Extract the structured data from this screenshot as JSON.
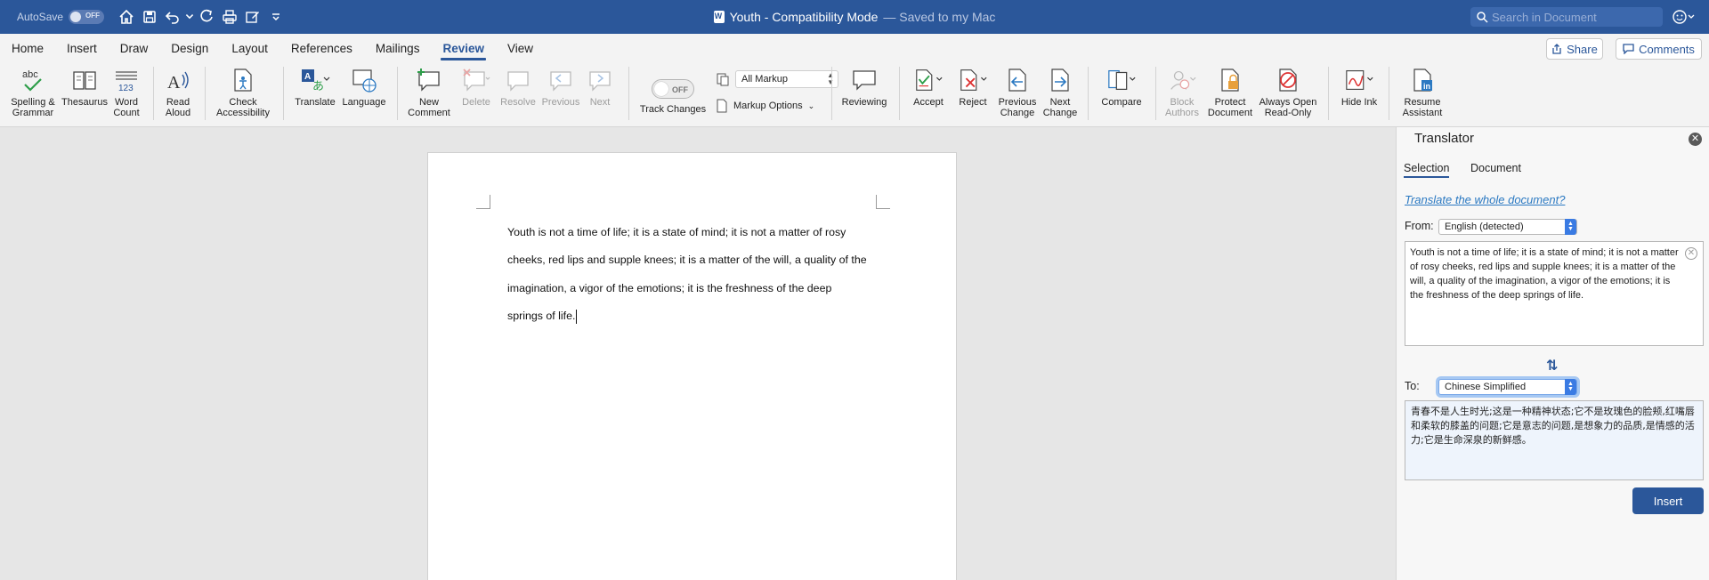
{
  "titlebar": {
    "autosave_label": "AutoSave",
    "autosave_state": "OFF",
    "doc_title": "Youth  -  Compatibility Mode",
    "saved_status": "— Saved to my Mac",
    "search_placeholder": "Search in Document"
  },
  "tabs": [
    "Home",
    "Insert",
    "Draw",
    "Design",
    "Layout",
    "References",
    "Mailings",
    "Review",
    "View"
  ],
  "active_tab": "Review",
  "share_label": "Share",
  "comments_label": "Comments",
  "ribbon": {
    "spelling": "Spelling &\nGrammar",
    "thesaurus": "Thesaurus",
    "word_count": "Word\nCount",
    "read_aloud": "Read\nAloud",
    "check_accessibility": "Check\nAccessibility",
    "translate": "Translate",
    "language": "Language",
    "new_comment": "New\nComment",
    "delete": "Delete",
    "resolve": "Resolve",
    "previous": "Previous",
    "next": "Next",
    "track_changes_state": "OFF",
    "track_changes": "Track Changes",
    "markup_value": "All Markup",
    "markup_options": "Markup Options",
    "reviewing": "Reviewing",
    "accept": "Accept",
    "reject": "Reject",
    "previous_change": "Previous\nChange",
    "next_change": "Next\nChange",
    "compare": "Compare",
    "block_authors": "Block\nAuthors",
    "protect_document": "Protect\nDocument",
    "always_open_readonly": "Always Open\nRead-Only",
    "hide_ink": "Hide Ink",
    "resume_assistant": "Resume\nAssistant"
  },
  "document": {
    "lines": [
      "Youth is not a time of life; it is a state of mind; it is not a matter of rosy",
      "cheeks, red lips and supple knees; it is a matter of the will, a quality of the",
      "imagination, a vigor of the emotions; it is the freshness of the deep",
      "springs of life."
    ]
  },
  "translator": {
    "title": "Translator",
    "tab_selection": "Selection",
    "tab_document": "Document",
    "translate_link": "Translate the whole document?",
    "from_label": "From:",
    "from_value": "English (detected)",
    "source_text": "Youth is not a time of life; it is a state of mind; it is not a matter of rosy cheeks, red lips and supple knees; it is a matter of the will, a quality of the imagination, a vigor of the emotions; it is the freshness of the deep springs of life.",
    "to_label": "To:",
    "to_value": "Chinese Simplified",
    "translated_text": "青春不是人生时光;这是一种精神状态;它不是玫瑰色的脸颊,红嘴唇和柔软的膝盖的问题;它是意志的问题,是想象力的品质,是情感的活力;它是生命深泉的新鲜感。",
    "insert_label": "Insert"
  }
}
